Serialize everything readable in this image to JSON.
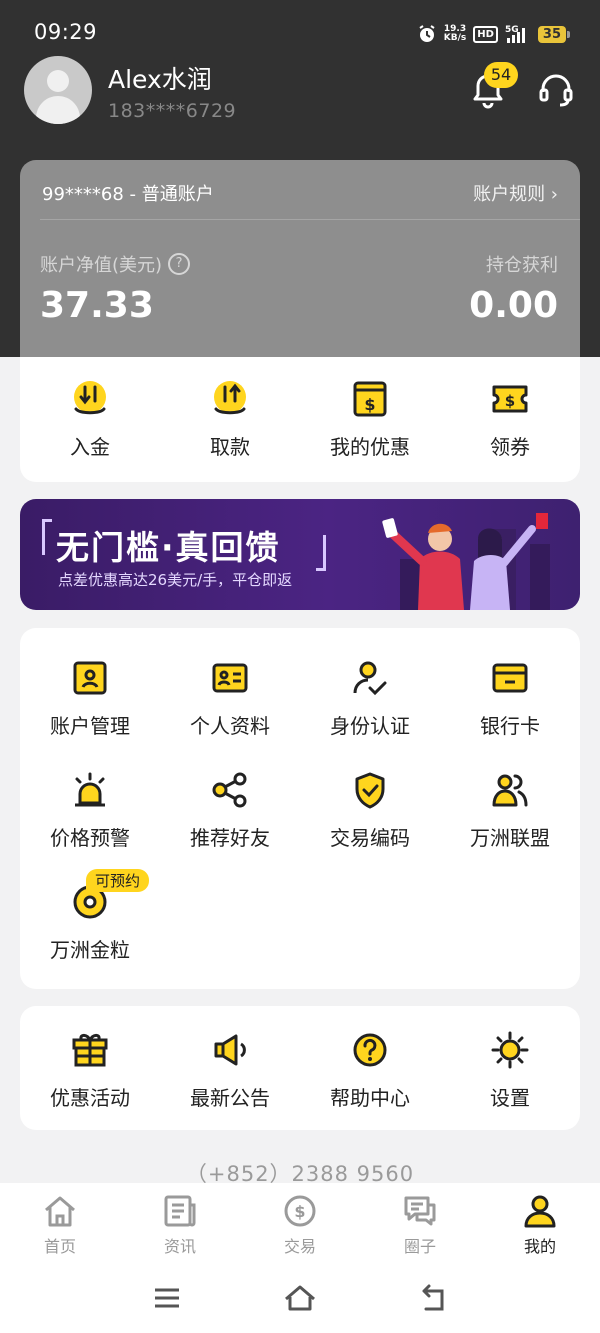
{
  "status_bar": {
    "time": "09:29",
    "net_speed_value": "19.3",
    "net_speed_unit": "KB/s",
    "hd": "HD",
    "signal": "5G",
    "battery": "35"
  },
  "profile": {
    "name": "Alex水润",
    "phone": "183****6729",
    "notification_count": "54"
  },
  "account": {
    "id_line": "99****68 - 普通账户",
    "rules_link": "账户规则 ›",
    "net_value_label": "账户净值(美元)",
    "net_value_help": "?",
    "net_value": "37.33",
    "profit_label": "持仓获利",
    "profit_value": "0.00"
  },
  "quick_actions": [
    {
      "label": "入金",
      "icon": "deposit-icon"
    },
    {
      "label": "取款",
      "icon": "withdraw-icon"
    },
    {
      "label": "我的优惠",
      "icon": "my-offers-icon"
    },
    {
      "label": "领券",
      "icon": "coupon-icon"
    }
  ],
  "banner": {
    "title": "无门槛·真回馈",
    "subtitle": "点差优惠高达26美元/手，平仓即返"
  },
  "services": [
    {
      "label": "账户管理",
      "icon": "account-manage-icon"
    },
    {
      "label": "个人资料",
      "icon": "profile-card-icon"
    },
    {
      "label": "身份认证",
      "icon": "identity-verify-icon"
    },
    {
      "label": "银行卡",
      "icon": "bank-card-icon"
    },
    {
      "label": "价格预警",
      "icon": "alarm-icon"
    },
    {
      "label": "推荐好友",
      "icon": "share-icon"
    },
    {
      "label": "交易编码",
      "icon": "shield-check-icon"
    },
    {
      "label": "万洲联盟",
      "icon": "alliance-icon"
    },
    {
      "label": "万洲金粒",
      "icon": "gold-grain-icon",
      "badge": "可预约"
    }
  ],
  "more": [
    {
      "label": "优惠活动",
      "icon": "gift-icon"
    },
    {
      "label": "最新公告",
      "icon": "megaphone-icon"
    },
    {
      "label": "帮助中心",
      "icon": "help-icon"
    },
    {
      "label": "设置",
      "icon": "settings-sun-icon"
    }
  ],
  "contact_phone": "（+852）2388 9560",
  "tabs": [
    {
      "label": "首页",
      "icon": "home-icon",
      "active": false
    },
    {
      "label": "资讯",
      "icon": "news-icon",
      "active": false
    },
    {
      "label": "交易",
      "icon": "trade-dollar-icon",
      "active": false
    },
    {
      "label": "圈子",
      "icon": "chat-icon",
      "active": false
    },
    {
      "label": "我的",
      "icon": "user-icon",
      "active": true
    }
  ],
  "colors": {
    "accent": "#ffd51e",
    "dark_header": "#313131",
    "card_gray": "#8e8e8e",
    "page_bg": "#f2f2f3"
  }
}
